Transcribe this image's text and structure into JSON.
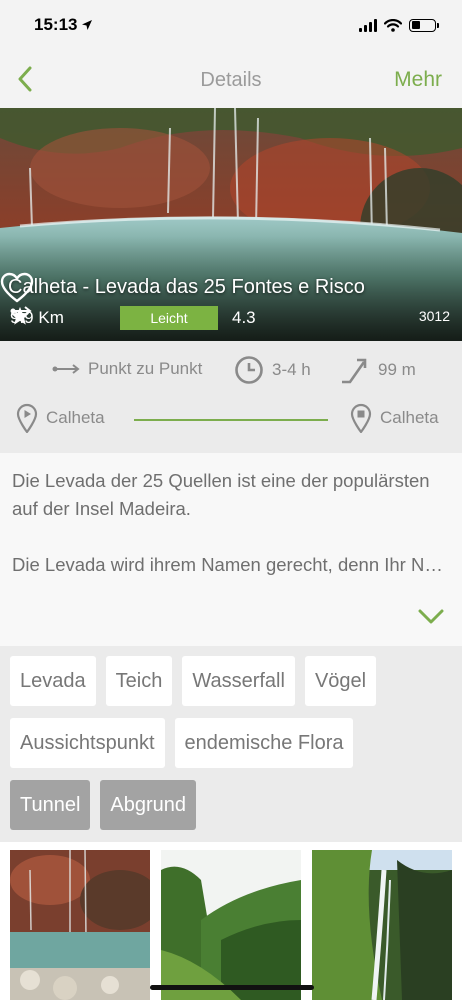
{
  "status_bar": {
    "time": "15:13"
  },
  "nav": {
    "title": "Details",
    "more_label": "Mehr"
  },
  "hero": {
    "title": "Calheta - Levada das 25 Fontes e Risco",
    "distance": "9.9 Km",
    "difficulty": "Leicht",
    "rating": "4.3",
    "likes": "3012"
  },
  "info": {
    "route_type": "Punkt zu Punkt",
    "duration": "3-4 h",
    "elevation": "99 m",
    "start": "Calheta",
    "end": "Calheta"
  },
  "description": {
    "p1": "Die Levada der 25 Quellen ist eine der populärsten auf der Insel Madeira.",
    "p2": "Die Levada wird ihrem Namen gerecht, denn Ihr Name bezieht sich auf die verschiedene…"
  },
  "tags": {
    "row1": [
      "Levada",
      "Teich",
      "Wasserfall",
      "Vögel"
    ],
    "row2": [
      "Aussichtspunkt",
      "endemische Flora"
    ],
    "row3": [
      "Tunnel",
      "Abgrund"
    ]
  },
  "colors": {
    "accent": "#7cad4d",
    "badge": "#7cb342"
  }
}
